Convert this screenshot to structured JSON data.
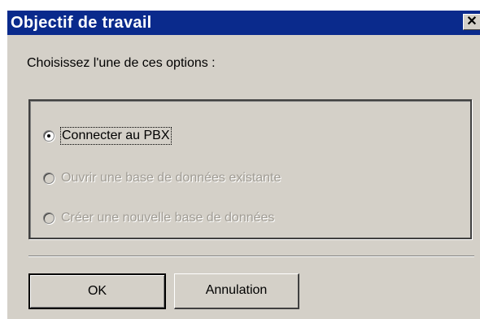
{
  "dialog": {
    "title": "Objectif de travail",
    "close_label": "✕",
    "prompt": "Choisissez l'une de ces options :"
  },
  "options": [
    {
      "label": "Connecter au PBX",
      "selected": true,
      "enabled": true
    },
    {
      "label": "Ouvrir une base de données existante",
      "selected": false,
      "enabled": false
    },
    {
      "label": "Créer une nouvelle base de données",
      "selected": false,
      "enabled": false
    }
  ],
  "buttons": {
    "ok_label": "OK",
    "cancel_label": "Annulation"
  },
  "colors": {
    "titlebar": "#0a2a8c",
    "dialog_bg": "#d4d0c8",
    "disabled_text": "#a09c94"
  }
}
